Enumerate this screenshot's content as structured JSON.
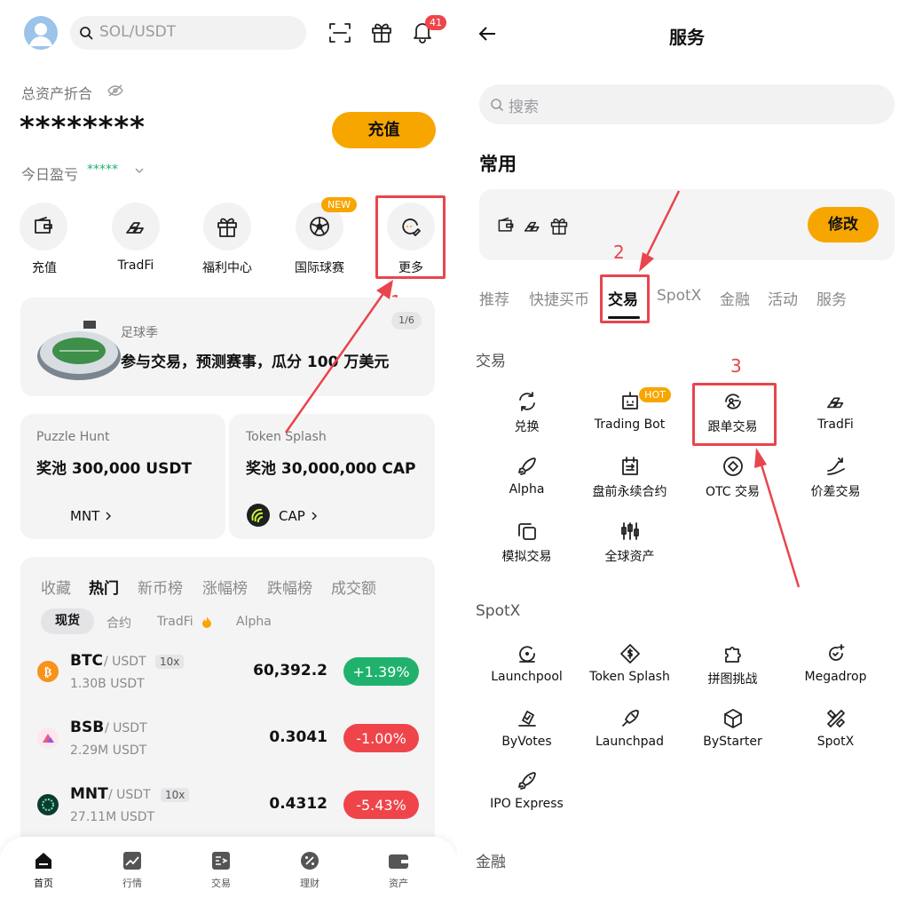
{
  "left": {
    "search_placeholder": "SOL/USDT",
    "notif_count": "41",
    "assets_label": "总资产折合",
    "assets_value": "********",
    "deposit_button": "充值",
    "pnl_label": "今日盈亏",
    "pnl_value": "*****",
    "quick": [
      {
        "label": "充值",
        "icon": "wallet-icon"
      },
      {
        "label": "TradFi",
        "icon": "gold-bars-icon"
      },
      {
        "label": "福利中心",
        "icon": "gift-icon"
      },
      {
        "label": "国际球赛",
        "icon": "soccer-ball-icon"
      },
      {
        "label": "更多",
        "icon": "more-icon"
      }
    ],
    "new_badge": "NEW",
    "banner": {
      "kicker": "足球季",
      "title": "参与交易，预测赛事，瓜分 100 万美元",
      "page": "1/6"
    },
    "promo": [
      {
        "name": "Puzzle Hunt",
        "prize": "奖池 300,000 USDT",
        "token": "MNT"
      },
      {
        "name": "Token Splash",
        "prize": "奖池 30,000,000 CAP",
        "token": "CAP"
      }
    ],
    "market_tabs": [
      "收藏",
      "热门",
      "新币榜",
      "涨幅榜",
      "跌幅榜",
      "成交额"
    ],
    "market_tab_active": "热门",
    "sub_tabs": [
      "现货",
      "合约",
      "TradFi",
      "Alpha"
    ],
    "rows": [
      {
        "base": "BTC",
        "quote": "/ USDT",
        "lev": "10x",
        "vol": "1.30B USDT",
        "price": "60,392.2",
        "pct": "+1.39%",
        "up": true
      },
      {
        "base": "BSB",
        "quote": "/ USDT",
        "lev": "",
        "vol": "2.29M USDT",
        "price": "0.3041",
        "pct": "-1.00%",
        "up": false
      },
      {
        "base": "MNT",
        "quote": "/ USDT",
        "lev": "10x",
        "vol": "27.11M USDT",
        "price": "0.4312",
        "pct": "-5.43%",
        "up": false
      }
    ],
    "nav": [
      "首页",
      "行情",
      "交易",
      "理财",
      "资产"
    ]
  },
  "right": {
    "title": "服务",
    "search_placeholder": "搜索",
    "common_title": "常用",
    "edit_button": "修改",
    "tabs": [
      "推荐",
      "快捷买币",
      "交易",
      "SpotX",
      "金融",
      "活动",
      "服务"
    ],
    "active_tab": "交易",
    "section_trade": "交易",
    "trade_items": [
      {
        "label": "兑换",
        "icon": "swap-icon"
      },
      {
        "label": "Trading Bot",
        "icon": "robot-icon",
        "badge": "HOT"
      },
      {
        "label": "跟单交易",
        "icon": "copy-trade-icon"
      },
      {
        "label": "TradFi",
        "icon": "gold-bars-icon"
      },
      {
        "label": "Alpha",
        "icon": "rocket-icon"
      },
      {
        "label": "盘前永续合约",
        "icon": "calendar-contract-icon"
      },
      {
        "label": "OTC 交易",
        "icon": "otc-icon"
      },
      {
        "label": "价差交易",
        "icon": "spread-icon"
      },
      {
        "label": "模拟交易",
        "icon": "copy-squares-icon"
      },
      {
        "label": "全球资产",
        "icon": "candles-icon"
      }
    ],
    "section_spotx": "SpotX",
    "spotx_items": [
      {
        "label": "Launchpool",
        "icon": "launchpool-icon"
      },
      {
        "label": "Token Splash",
        "icon": "token-splash-icon"
      },
      {
        "label": "拼图挑战",
        "icon": "puzzle-icon"
      },
      {
        "label": "Megadrop",
        "icon": "megadrop-icon"
      },
      {
        "label": "ByVotes",
        "icon": "vote-icon"
      },
      {
        "label": "Launchpad",
        "icon": "launchpad-icon"
      },
      {
        "label": "ByStarter",
        "icon": "cube-icon"
      },
      {
        "label": "SpotX",
        "icon": "spotx-icon"
      },
      {
        "label": "IPO Express",
        "icon": "rocket-icon"
      }
    ],
    "section_finance": "金融"
  },
  "annotations": [
    "1",
    "2",
    "3"
  ],
  "colors": {
    "accent": "#f7a600",
    "up": "#20b26c",
    "down": "#ef454a",
    "annotation": "#e8454d"
  }
}
